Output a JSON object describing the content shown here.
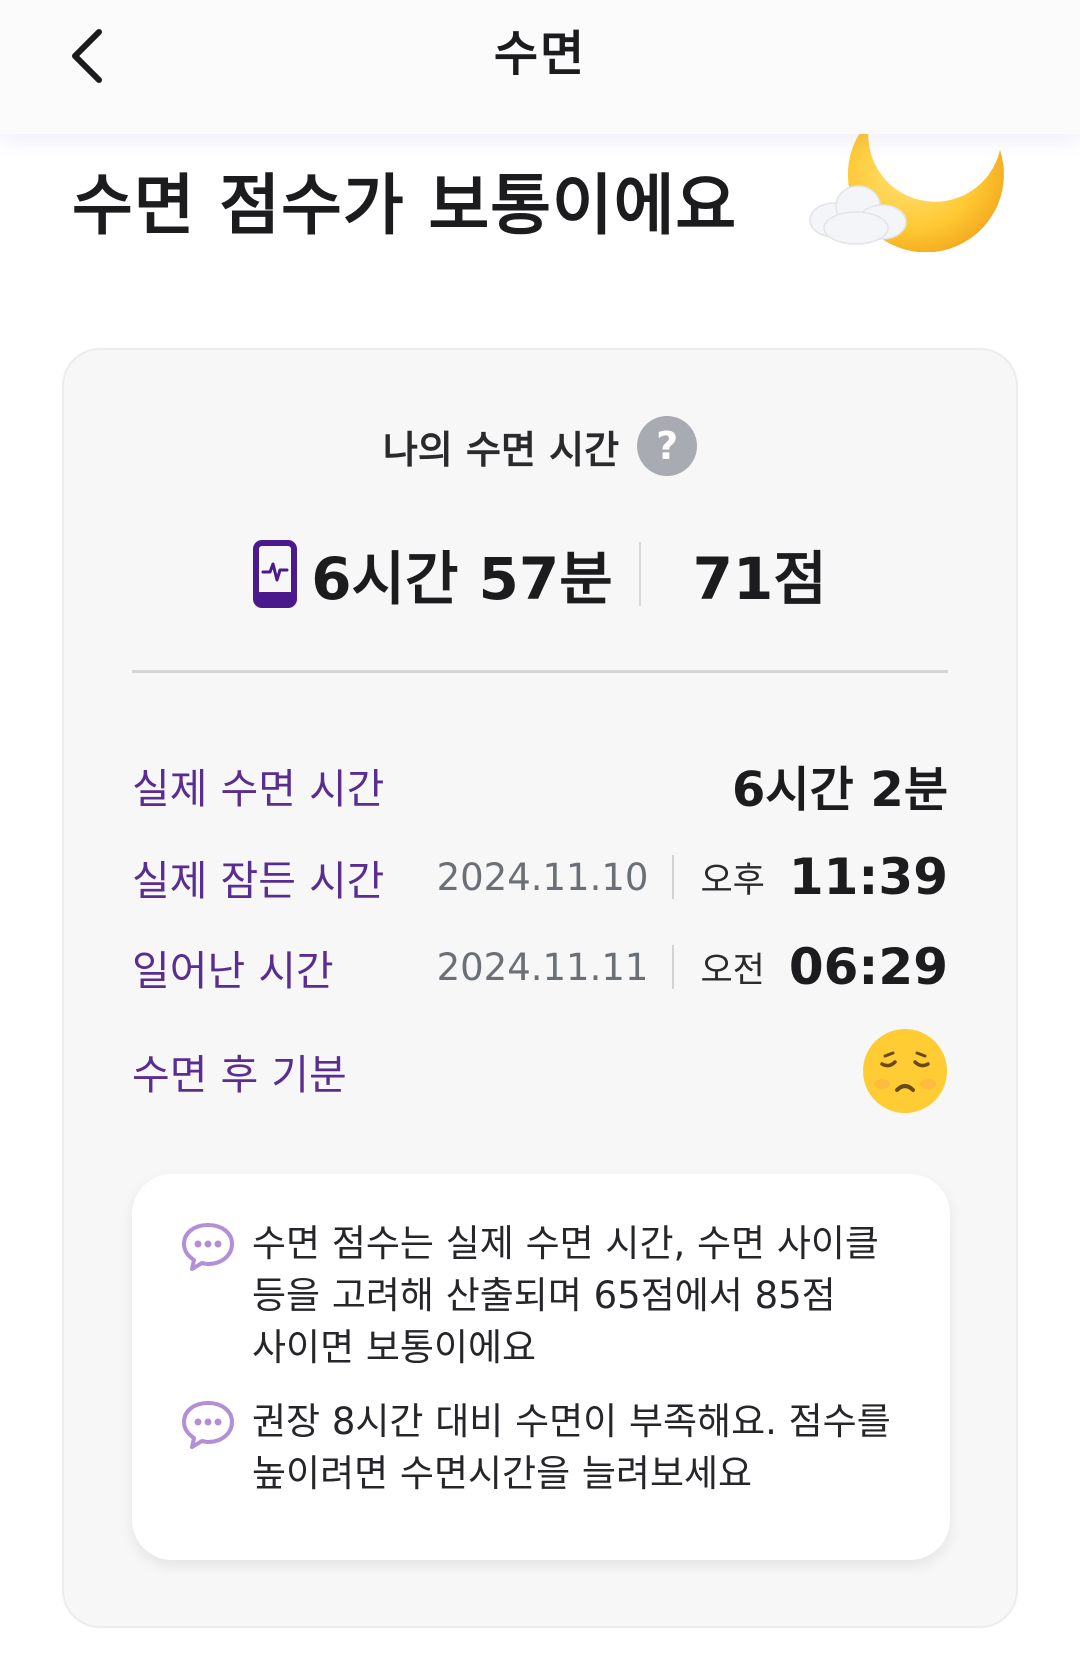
{
  "header": {
    "title": "수면"
  },
  "headline": "수면 점수가 보통이에요",
  "card": {
    "title": "나의 수면 시간",
    "summary": {
      "duration": "6시간 57분",
      "score": "71점"
    },
    "details": {
      "actual_sleep": {
        "label": "실제 수면 시간",
        "value": "6시간 2분"
      },
      "fell_asleep": {
        "label": "실제 잠든 시간",
        "date": "2024.11.10",
        "ampm": "오후",
        "time": "11:39"
      },
      "woke_up": {
        "label": "일어난 시간",
        "date": "2024.11.11",
        "ampm": "오전",
        "time": "06:29"
      },
      "mood": {
        "label": "수면 후 기분",
        "icon": "tired-face-emoji"
      }
    },
    "tips": [
      {
        "icon": "chat-bubble-icon",
        "lines": [
          "수면 점수는 실제 수면 시간, 수면 사이클",
          "등을 고려해 산출되며 65점에서 85점",
          "사이면 보통이에요"
        ]
      },
      {
        "icon": "chat-bubble-icon",
        "lines": [
          "권장 8시간 대비 수면이 부족해요. 점수를",
          "높이려면 수면시간을 늘려보세요"
        ]
      }
    ]
  },
  "colors": {
    "accent_purple": "#5a2d91",
    "device_icon": "#4a1a8c",
    "tip_icon": "#b38fd6",
    "emoji": "#ffcc33"
  }
}
